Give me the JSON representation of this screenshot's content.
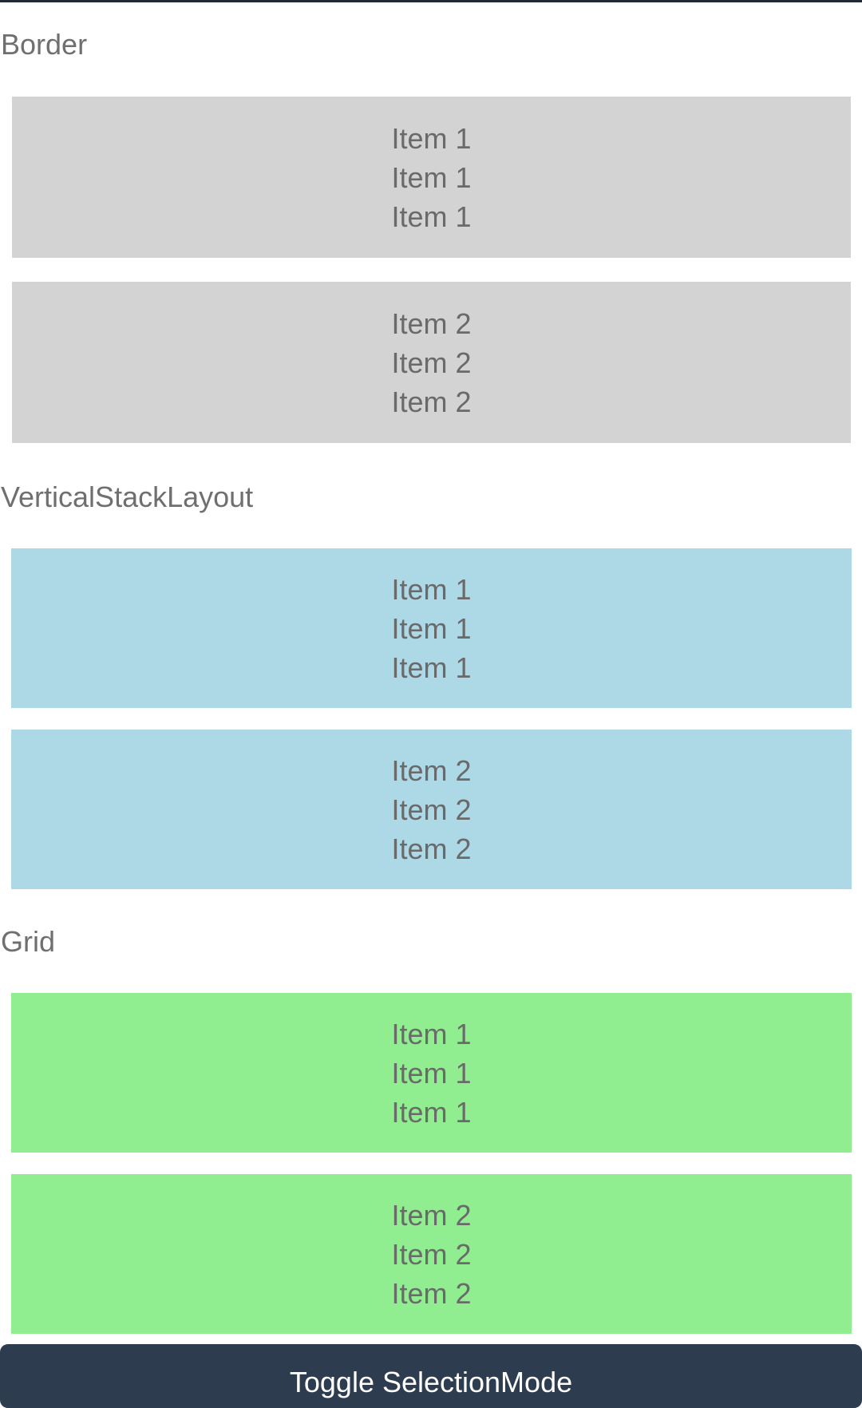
{
  "sections": [
    {
      "title": "Border",
      "color": "#d3d3d3",
      "items": [
        {
          "lines": [
            "Item 1",
            "Item 1",
            "Item 1"
          ]
        },
        {
          "lines": [
            "Item 2",
            "Item 2",
            "Item 2"
          ]
        }
      ]
    },
    {
      "title": "VerticalStackLayout",
      "color": "#add8e6",
      "items": [
        {
          "lines": [
            "Item 1",
            "Item 1",
            "Item 1"
          ]
        },
        {
          "lines": [
            "Item 2",
            "Item 2",
            "Item 2"
          ]
        }
      ]
    },
    {
      "title": "Grid",
      "color": "#90ee90",
      "items": [
        {
          "lines": [
            "Item 1",
            "Item 1",
            "Item 1"
          ]
        },
        {
          "lines": [
            "Item 2",
            "Item 2",
            "Item 2"
          ]
        }
      ]
    }
  ],
  "toggle_button": {
    "label": "Toggle SelectionMode",
    "color": "#2e3c4f"
  }
}
